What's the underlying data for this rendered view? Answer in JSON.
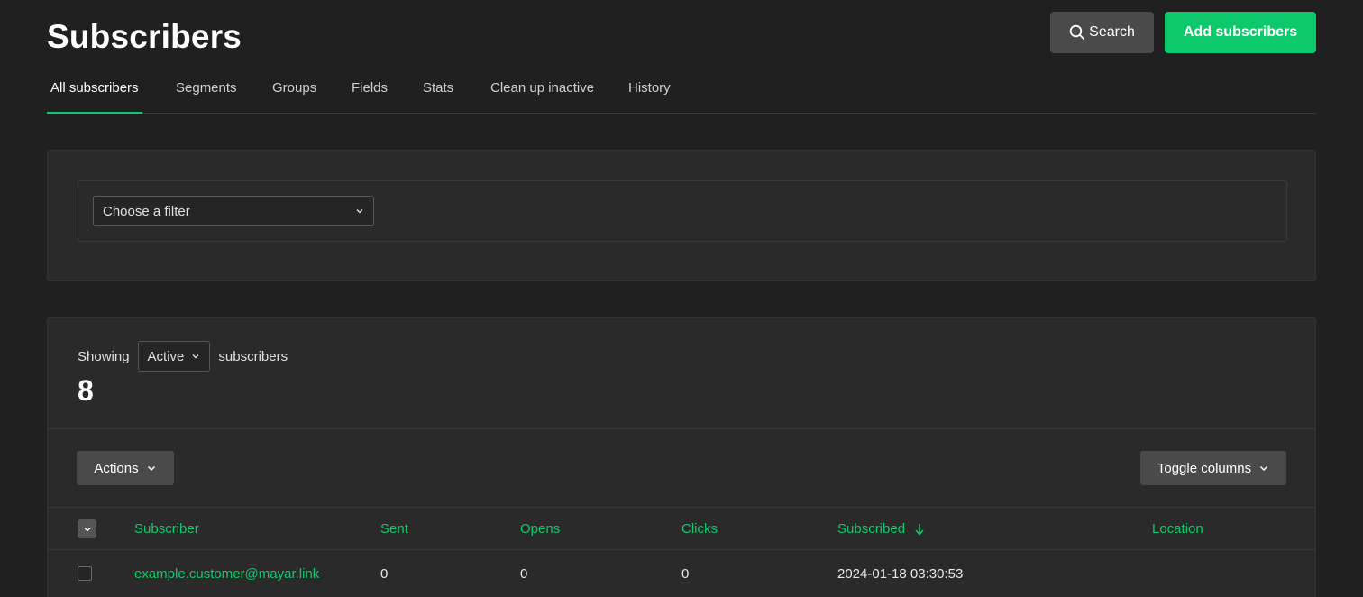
{
  "header": {
    "title": "Subscribers",
    "search_label": "Search",
    "add_label": "Add subscribers"
  },
  "tabs": [
    {
      "label": "All subscribers",
      "active": true
    },
    {
      "label": "Segments"
    },
    {
      "label": "Groups"
    },
    {
      "label": "Fields"
    },
    {
      "label": "Stats"
    },
    {
      "label": "Clean up inactive"
    },
    {
      "label": "History"
    }
  ],
  "filter": {
    "placeholder": "Choose a filter"
  },
  "list": {
    "showing_prefix": "Showing",
    "status": "Active",
    "showing_suffix": "subscribers",
    "count": "8",
    "actions_label": "Actions",
    "toggle_columns_label": "Toggle columns",
    "columns": [
      "Subscriber",
      "Sent",
      "Opens",
      "Clicks",
      "Subscribed",
      "Location"
    ],
    "sort_column": "Subscribed",
    "rows": [
      {
        "subscriber": "example.customer@mayar.link",
        "sent": "0",
        "opens": "0",
        "clicks": "0",
        "subscribed": "2024-01-18 03:30:53",
        "location": ""
      }
    ]
  },
  "colors": {
    "background": "#202020",
    "panel": "#2a2a2a",
    "accent": "#0ec96b",
    "button_dark": "#4a4a4a"
  },
  "icons": [
    "search-icon",
    "chevron-down-icon",
    "sort-down-arrow-icon"
  ]
}
